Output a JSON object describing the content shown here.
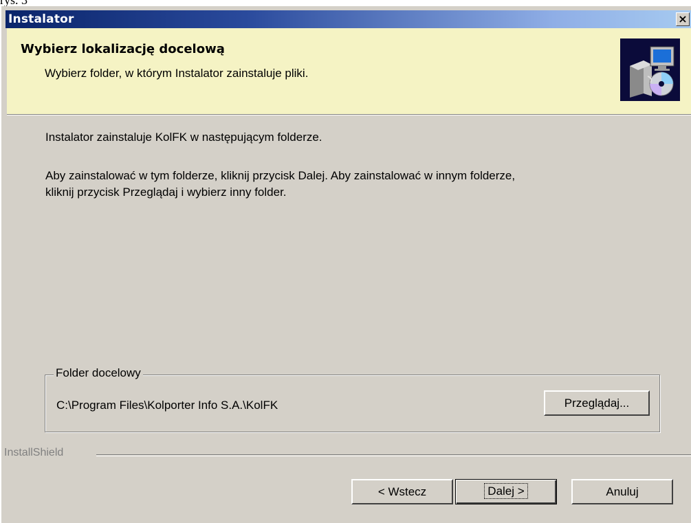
{
  "caption": "rys. 3",
  "window": {
    "title": "Instalator",
    "close_label": "×"
  },
  "header": {
    "title": "Wybierz lokalizację docelową",
    "subtitle": "Wybierz folder, w którym Instalator zainstaluje pliki.",
    "icon": "installer-icon"
  },
  "body": {
    "line1": "Instalator zainstaluje KolFK w następującym folderze.",
    "line2": "Aby zainstalować w tym folderze, kliknij przycisk Dalej. Aby zainstalować w innym folderze,",
    "line3": "kliknij przycisk Przeglądaj i wybierz inny folder."
  },
  "folder": {
    "legend": "Folder docelowy",
    "path": "C:\\Program Files\\Kolporter Info S.A.\\KolFK",
    "browse_label": "Przeglądaj..."
  },
  "footer": {
    "brand": "InstallShield",
    "back_label": "< Wstecz",
    "next_label": "Dalej >",
    "cancel_label": "Anuluj"
  },
  "colors": {
    "title_bar_start": "#0a246a",
    "title_bar_end": "#a6caf0",
    "header_bg": "#f5f3c4",
    "dialog_bg": "#d4d0c8"
  }
}
